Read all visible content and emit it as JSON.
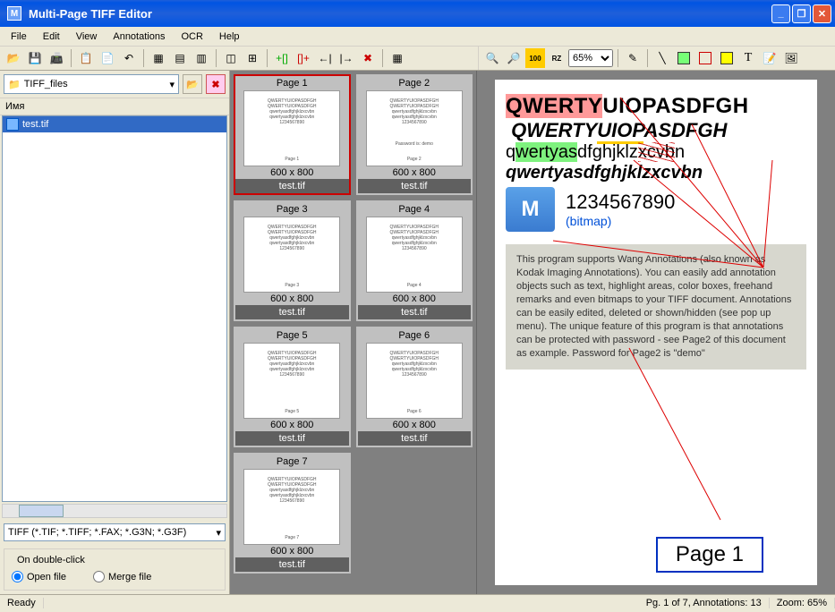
{
  "title": "Multi-Page TIFF Editor",
  "menu": {
    "file": "File",
    "edit": "Edit",
    "view": "View",
    "annotations": "Annotations",
    "ocr": "OCR",
    "help": "Help"
  },
  "zoom": "65%",
  "folder": "TIFF_files",
  "filehead": "Имя",
  "filelist": [
    "test.tif"
  ],
  "filetype": "TIFF (*.TIF; *.TIFF; *.FAX; *.G3N; *.G3F)",
  "dblclick": {
    "group": "On double-click",
    "open": "Open file",
    "merge": "Merge file"
  },
  "thumbs": [
    {
      "label": "Page 1",
      "dim": "600 x 800",
      "file": "test.tif",
      "sel": true,
      "text": "QWERTYUIOPASDFGH\nQWERTYUIOPASDFGH\nqwertyasdfghjklzxcvbn\nqwertyasdfghjklzxcvbn\n1234567890",
      "pn": "Page 1"
    },
    {
      "label": "Page 2",
      "dim": "600 x 800",
      "file": "test.tif",
      "sel": false,
      "text": "QWERTYUIOPASDFGH\nQWERTYUIOPASDFGH\nqwertyasdfghjklzxcvbn\nqwertyasdfghjklzxcvbn\n1234567890",
      "pn": "Page 2",
      "pw": "Password is: demo"
    },
    {
      "label": "Page 3",
      "dim": "600 x 800",
      "file": "test.tif",
      "sel": false,
      "text": "QWERTYUIOPASDFGH\nQWERTYUIOPASDFGH\nqwertyasdfghjklzxcvbn\nqwertyasdfghjklzxcvbn\n1234567890",
      "pn": "Page 3"
    },
    {
      "label": "Page 4",
      "dim": "600 x 800",
      "file": "test.tif",
      "sel": false,
      "text": "QWERTYUIOPASDFGH\nQWERTYUIOPASDFGH\nqwertyasdfghjklzxcvbn\nqwertyasdfghjklzxcvbn\n1234567890",
      "pn": "Page 4"
    },
    {
      "label": "Page 5",
      "dim": "600 x 800",
      "file": "test.tif",
      "sel": false,
      "text": "QWERTYUIOPASDFGH\nQWERTYUIOPASDFGH\nqwertyasdfghjklzxcvbn\nqwertyasdfghjklzxcvbn\n1234567890",
      "pn": "Page 5"
    },
    {
      "label": "Page 6",
      "dim": "600 x 800",
      "file": "test.tif",
      "sel": false,
      "text": "QWERTYUIOPASDFGH\nQWERTYUIOPASDFGH\nqwertyasdfghjklzxcvbn\nqwertyasdfghjklzxcvbn\n1234567890",
      "pn": "Page 6"
    },
    {
      "label": "Page 7",
      "dim": "600 x 800",
      "file": "test.tif",
      "sel": false,
      "text": "QWERTYUIOPASDFGH\nQWERTYUIOPASDFGH\nqwertyasdfghjklzxcvbn\nqwertyasdfghjklzxcvbn\n1234567890",
      "pn": "Page 7"
    }
  ],
  "page": {
    "l1a": "QWERTY",
    "l1b": "UIOPASDFGH",
    "l2a": "QWERTY",
    "l2b": "UIOP",
    "l2c": "ASDFGH",
    "l3a": "q",
    "l3b": "wertyas",
    "l3c": "dfghjklz",
    "l3d": "xcvb",
    "l3e": "n",
    "l4": "qwertyasdfghjklzxcvbn",
    "nums": "1234567890",
    "bitmap": "(bitmap)",
    "anno": "This program supports Wang Annotations (also known as Kodak Imaging Annotations). You can easily add annotation objects such as text, highlight areas, color boxes, freehand remarks and even bitmaps to your TIFF document. Annotations can be easily edited, deleted or shown/hidden (see pop up menu). The unique feature of this program is that annotations can be protected with password - see Page2 of this document as example. Password for Page2 is \"demo\"",
    "pagenum": "Page 1"
  },
  "status": {
    "ready": "Ready",
    "pg": "Pg. 1 of 7, Annotations: 13",
    "zoom": "Zoom: 65%"
  }
}
